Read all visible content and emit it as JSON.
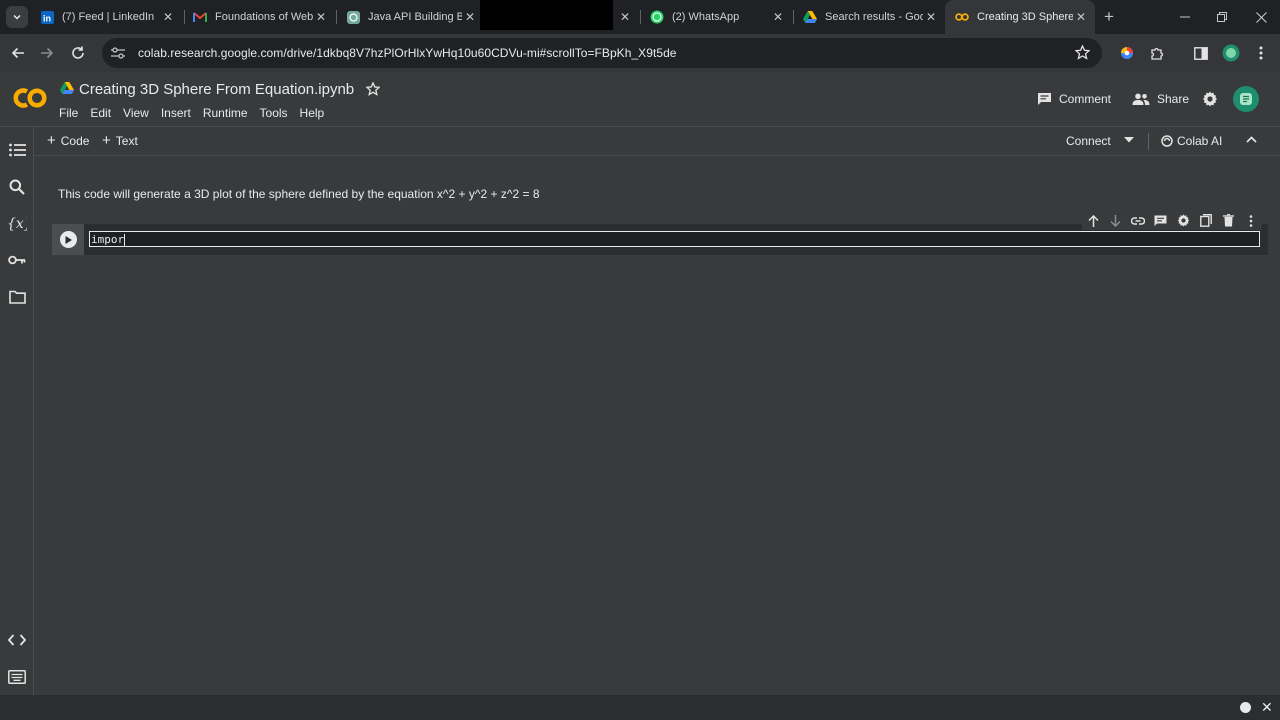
{
  "browser": {
    "tabs": [
      {
        "title": "(7) Feed | LinkedIn",
        "icon": "linkedin-icon"
      },
      {
        "title": "Foundations of Web",
        "icon": "gmail-icon"
      },
      {
        "title": "Java API Building Ba",
        "icon": "chatgpt-icon"
      },
      {
        "title": "(2) WhatsApp",
        "icon": "whatsapp-icon"
      },
      {
        "title": "Search results - Goo",
        "icon": "drive-icon"
      },
      {
        "title": "Creating 3D Sphere F",
        "icon": "colab-icon"
      }
    ],
    "url": "colab.research.google.com/drive/1dkbq8V7hzPlOrHlxYwHq10u60CDVu-mi#scrollTo=FBpKh_X9t5de"
  },
  "colab": {
    "notebook_title": "Creating 3D Sphere From Equation.ipynb",
    "menu": [
      "File",
      "Edit",
      "View",
      "Insert",
      "Runtime",
      "Tools",
      "Help"
    ],
    "comment_label": "Comment",
    "share_label": "Share",
    "add_code_label": "Code",
    "add_text_label": "Text",
    "connect_label": "Connect",
    "colab_ai_label": "Colab AI"
  },
  "cells": {
    "text_cell": "This code will generate a 3D plot of the sphere defined by the equation x^2 + y^2 + z^2 = 8",
    "code_cell": "impor"
  },
  "colors": {
    "background": "#383a3b",
    "tabstrip": "#202124",
    "colab_orange": "#f9ab00"
  }
}
